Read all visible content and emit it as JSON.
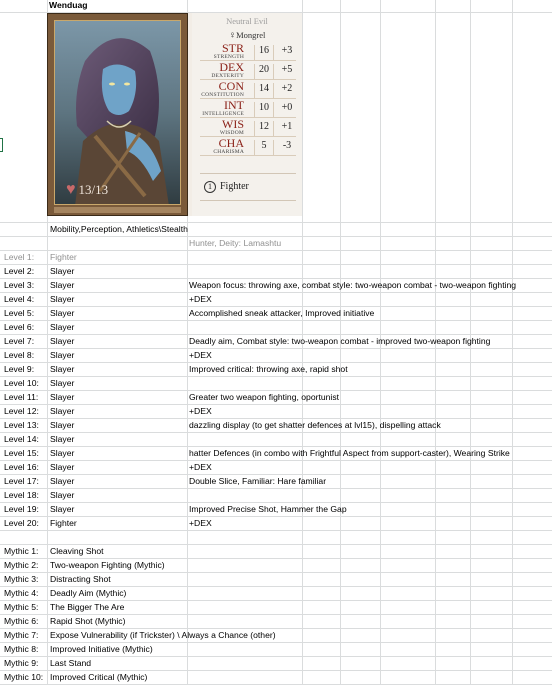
{
  "sheet": {
    "character_name": "Wenduag",
    "skills": "Mobility,Perception, Athletics\\Stealth",
    "archetype": "Hunter, Deity: Lamashtu"
  },
  "card": {
    "alignment": "Neutral Evil",
    "race_symbol": "♀",
    "race": "Mongrel",
    "hp": "13/13",
    "class_level": "1",
    "class_name": "Fighter",
    "stats": [
      {
        "abbr": "STR",
        "full": "STRENGTH",
        "value": "16",
        "mod": "+3"
      },
      {
        "abbr": "DEX",
        "full": "DEXTERITY",
        "value": "20",
        "mod": "+5"
      },
      {
        "abbr": "CON",
        "full": "CONSTITUTION",
        "value": "14",
        "mod": "+2"
      },
      {
        "abbr": "INT",
        "full": "INTELLIGENCE",
        "value": "10",
        "mod": "+0"
      },
      {
        "abbr": "WIS",
        "full": "WISDOM",
        "value": "12",
        "mod": "+1"
      },
      {
        "abbr": "CHA",
        "full": "CHARISMA",
        "value": "5",
        "mod": "-3"
      }
    ]
  },
  "levels": [
    {
      "label": "Level 1:",
      "class": "Fighter",
      "note": ""
    },
    {
      "label": "Level 2:",
      "class": "Slayer",
      "note": ""
    },
    {
      "label": "Level 3:",
      "class": "Slayer",
      "note": "Weapon focus: throwing axe, combat style: two-weapon combat - two-weapon fighting"
    },
    {
      "label": "Level 4:",
      "class": "Slayer",
      "note": "+DEX"
    },
    {
      "label": "Level 5:",
      "class": "Slayer",
      "note": "Accomplished sneak attacker, Improved initiative"
    },
    {
      "label": "Level 6:",
      "class": "Slayer",
      "note": ""
    },
    {
      "label": "Level 7:",
      "class": "Slayer",
      "note": "Deadly aim, Combat style: two-weapon combat - improved two-weapon fighting"
    },
    {
      "label": "Level 8:",
      "class": "Slayer",
      "note": "+DEX"
    },
    {
      "label": "Level 9:",
      "class": "Slayer",
      "note": "Improved critical: throwing axe, rapid shot"
    },
    {
      "label": "Level 10:",
      "class": "Slayer",
      "note": ""
    },
    {
      "label": "Level 11:",
      "class": "Slayer",
      "note": "Greater two weapon fighting, oportunist"
    },
    {
      "label": "Level 12:",
      "class": "Slayer",
      "note": "+DEX"
    },
    {
      "label": "Level 13:",
      "class": "Slayer",
      "note": "dazzling display (to get shatter defences at lvl15), dispelling attack"
    },
    {
      "label": "Level 14:",
      "class": "Slayer",
      "note": ""
    },
    {
      "label": "Level 15:",
      "class": "Slayer",
      "note": "hatter Defences (in combo with Frightful Aspect from support-caster), Wearing Strike"
    },
    {
      "label": "Level 16:",
      "class": "Slayer",
      "note": "+DEX"
    },
    {
      "label": "Level 17:",
      "class": "Slayer",
      "note": "Double Slice, Familiar: Hare familiar"
    },
    {
      "label": "Level 18:",
      "class": "Slayer",
      "note": ""
    },
    {
      "label": "Level 19:",
      "class": "Slayer",
      "note": "Improved Precise Shot, Hammer the Gap"
    },
    {
      "label": "Level 20:",
      "class": "Fighter",
      "note": "+DEX"
    }
  ],
  "mythic": [
    {
      "label": "Mythic 1:",
      "value": "Cleaving Shot"
    },
    {
      "label": "Mythic 2:",
      "value": "Two-weapon Fighting (Mythic)"
    },
    {
      "label": "Mythic 3:",
      "value": "Distracting Shot"
    },
    {
      "label": "Mythic 4:",
      "value": "Deadly Aim (Mythic)"
    },
    {
      "label": "Mythic 5:",
      "value": "The Bigger The Are"
    },
    {
      "label": "Mythic 6:",
      "value": "Rapid Shot (Mythic)"
    },
    {
      "label": "Mythic 7:",
      "value": "Expose Vulnerability (if Trickster) \\ Always a Chance (other)"
    },
    {
      "label": "Mythic 8:",
      "value": "Improved Initiative (Mythic)"
    },
    {
      "label": "Mythic 9:",
      "value": "Last Stand"
    },
    {
      "label": "Mythic 10:",
      "value": "Improved Critical (Mythic)"
    }
  ],
  "colors": {
    "grid": "#dadcdd",
    "stat_label": "#8a1f16",
    "gray_text": "#909090",
    "heart": "#c96a6a"
  }
}
